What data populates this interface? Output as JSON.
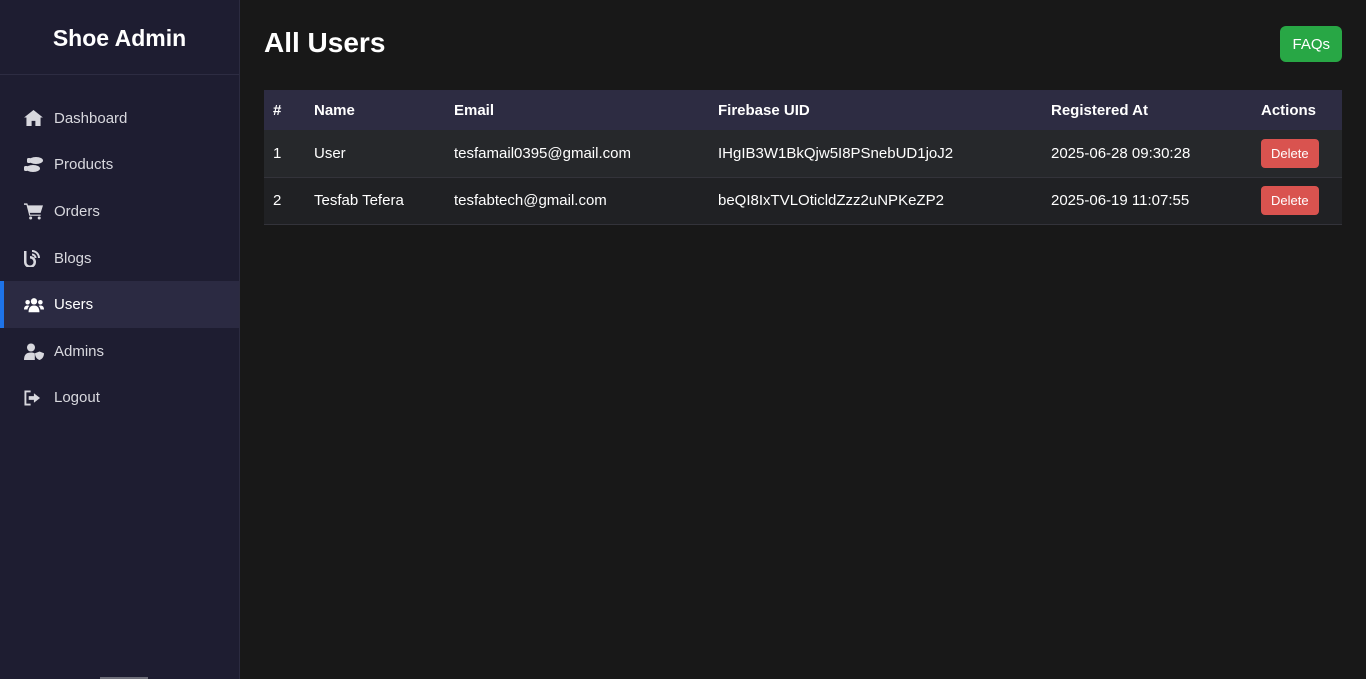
{
  "sidebar": {
    "brand": "Shoe Admin",
    "items": [
      {
        "label": "Dashboard",
        "icon": "home-icon"
      },
      {
        "label": "Products",
        "icon": "shoe-prints-icon"
      },
      {
        "label": "Orders",
        "icon": "cart-icon"
      },
      {
        "label": "Blogs",
        "icon": "blog-icon"
      },
      {
        "label": "Users",
        "icon": "users-icon",
        "active": true
      },
      {
        "label": "Admins",
        "icon": "user-shield-icon"
      },
      {
        "label": "Logout",
        "icon": "logout-icon"
      }
    ],
    "accent_color": "#1e73e8"
  },
  "header": {
    "title": "All Users",
    "faq_label": "FAQs"
  },
  "table": {
    "columns": [
      "#",
      "Name",
      "Email",
      "Firebase UID",
      "Registered At",
      "Actions"
    ],
    "rows": [
      {
        "num": "1",
        "name": "User",
        "email": "tesfamail0395@gmail.com",
        "uid": "IHgIB3W1BkQjw5I8PSnebUD1joJ2",
        "registered": "2025-06-28 09:30:28",
        "action": "Delete"
      },
      {
        "num": "2",
        "name": "Tesfab Tefera",
        "email": "tesfabtech@gmail.com",
        "uid": "beQI8IxTVLOticldZzz2uNPKeZP2",
        "registered": "2025-06-19 11:07:55",
        "action": "Delete"
      }
    ]
  },
  "colors": {
    "faq_button": "#28a745",
    "delete_button": "#d9534f",
    "sidebar_bg": "#1e1d31",
    "page_bg": "#181818"
  }
}
